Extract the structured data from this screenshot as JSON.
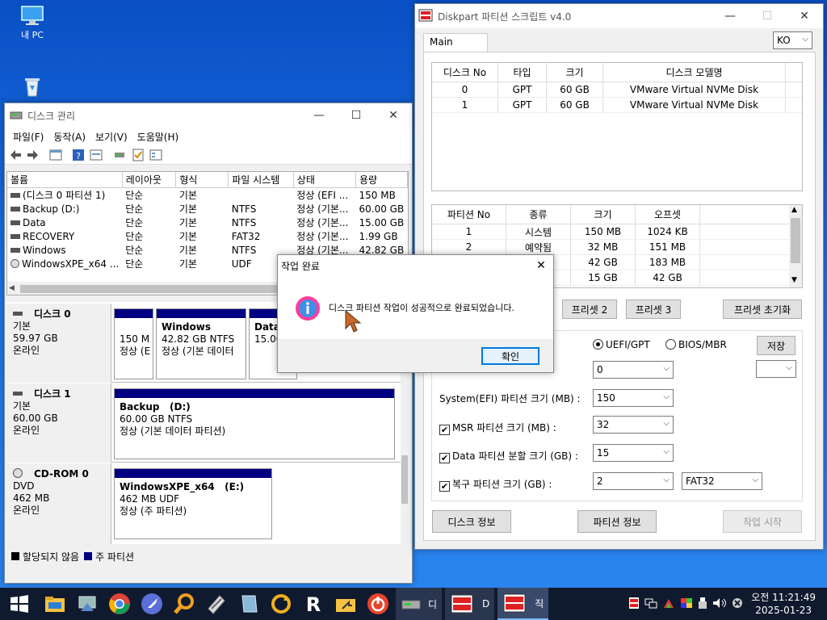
{
  "desktop": {
    "icons": [
      {
        "label": "내 PC"
      },
      {
        "label": ""
      }
    ]
  },
  "diskmgmt": {
    "title": "디스크 관리",
    "menu": [
      "파일(F)",
      "동작(A)",
      "보기(V)",
      "도움말(H)"
    ],
    "columns": [
      "볼륨",
      "레이아웃",
      "형식",
      "파일 시스템",
      "상태",
      "용량"
    ],
    "rows": [
      [
        "(디스크 0 파티션 1)",
        "단순",
        "기본",
        "",
        "정상 (EFI ...",
        "150 MB"
      ],
      [
        "Backup (D:)",
        "단순",
        "기본",
        "NTFS",
        "정상 (기본...",
        "60.00 GB"
      ],
      [
        "Data",
        "단순",
        "기본",
        "NTFS",
        "정상 (기본...",
        "15.00 GB"
      ],
      [
        "RECOVERY",
        "단순",
        "기본",
        "FAT32",
        "정상 (기본...",
        "1.99 GB"
      ],
      [
        "Windows",
        "단순",
        "기본",
        "NTFS",
        "정상 (기본...",
        "42.82 GB"
      ],
      [
        "WindowsXPE_x64 ...",
        "단순",
        "기본",
        "UDF",
        "",
        ""
      ]
    ],
    "disks": [
      {
        "name": "디스크 0",
        "type": "기본",
        "size": "59.97 GB",
        "status": "온라인",
        "parts": [
          {
            "l1": "",
            "l2": "150 M",
            "l3": "정상 (E"
          },
          {
            "l1": "Windows",
            "l2": "42.82 GB NTFS",
            "l3": "정상 (기본 데이터"
          },
          {
            "l1": "Data",
            "l2": "15.00",
            "l3": ""
          }
        ]
      },
      {
        "name": "디스크 1",
        "type": "기본",
        "size": "60.00 GB",
        "status": "온라인",
        "parts": [
          {
            "l1": "Backup   (D:)",
            "l2": "60.00 GB NTFS",
            "l3": "정상 (기본 데이터 파티션)"
          }
        ]
      },
      {
        "name": "CD-ROM 0",
        "type": "DVD",
        "size": "462 MB",
        "status": "온라인",
        "parts": [
          {
            "l1": "WindowsXPE_x64   (E:)",
            "l2": "462 MB UDF",
            "l3": "정상 (주 파티션)"
          }
        ]
      }
    ],
    "legend": [
      "할당되지 않음",
      "주 파티션"
    ]
  },
  "diskpart": {
    "title": "Diskpart 파티션 스크립트 v4.0",
    "tab": "Main",
    "lang": "KO",
    "disk_cols": [
      "디스크 No",
      "타입",
      "크기",
      "디스크 모델명"
    ],
    "disk_rows": [
      [
        "0",
        "GPT",
        "60 GB",
        "VMware Virtual NVMe Disk"
      ],
      [
        "1",
        "GPT",
        "60 GB",
        "VMware Virtual NVMe Disk"
      ]
    ],
    "part_cols": [
      "파티션 No",
      "종류",
      "크기",
      "오프셋"
    ],
    "part_rows": [
      [
        "1",
        "시스템",
        "150 MB",
        "1024 KB"
      ],
      [
        "2",
        "예약됨",
        "32 MB",
        "151 MB"
      ],
      [
        "",
        "",
        "42 GB",
        "183 MB"
      ],
      [
        "",
        "",
        "15 GB",
        "42 GB"
      ]
    ],
    "preset2": "프리셋 2",
    "preset3": "프리셋 3",
    "preset_reset": "프리셋 초기화",
    "uefi": "UEFI/GPT",
    "bios": "BIOS/MBR",
    "save": "저장",
    "disk_select_value": "0",
    "efi_label": "System(EFI) 파티션 크기 (MB) :",
    "efi_value": "150",
    "msr_label": "MSR 파티션 크기 (MB) :",
    "msr_value": "32",
    "data_label": "Data 파티션 분할 크기 (GB) :",
    "data_value": "15",
    "recovery_label": "복구 파티션 크기 (GB) :",
    "recovery_value": "2",
    "recovery_fs": "FAT32",
    "btn_disk_info": "디스크 정보",
    "btn_part_info": "파티션 정보",
    "btn_start": "작업 시작"
  },
  "dialog": {
    "title": "작업 완료",
    "message": "디스크 파티션 작업이 성공적으로 완료되었습니다.",
    "ok": "확인"
  },
  "taskbar": {
    "apps": [
      {
        "label": "디"
      },
      {
        "label": "D"
      },
      {
        "label": "직"
      }
    ],
    "time": "오전 11:21:49",
    "date": "2025-01-23"
  },
  "colors": {
    "primary_partition": "#000080",
    "accent": "#0078d7"
  }
}
